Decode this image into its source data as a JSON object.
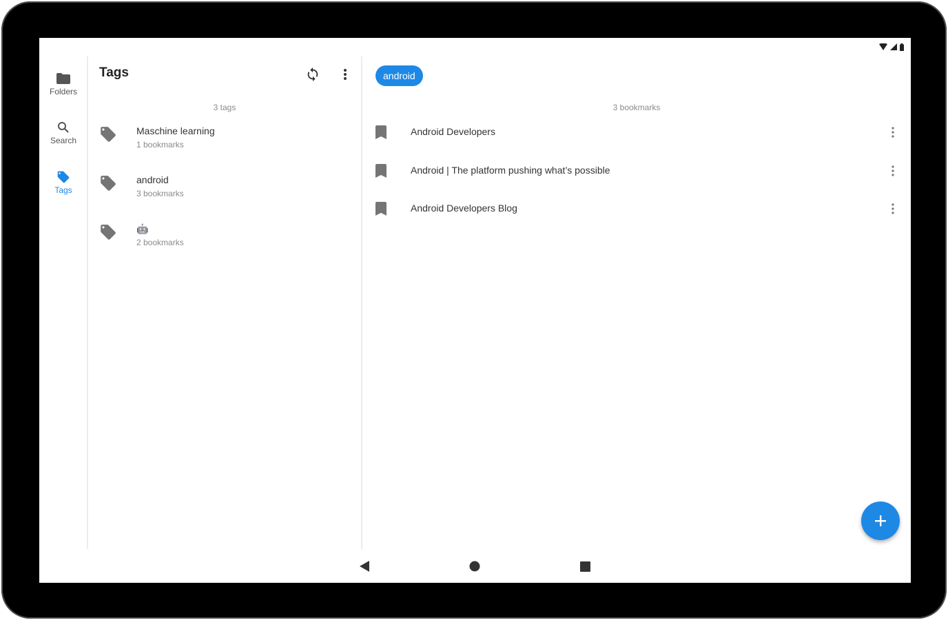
{
  "rail": {
    "items": [
      {
        "label": "Folders",
        "icon": "folder-icon",
        "active": false
      },
      {
        "label": "Search",
        "icon": "search-icon",
        "active": false
      },
      {
        "label": "Tags",
        "icon": "tag-icon",
        "active": true
      }
    ]
  },
  "tags_pane": {
    "title": "Tags",
    "count_label": "3 tags",
    "tags": [
      {
        "name": "Maschine learning",
        "count": "1 bookmarks"
      },
      {
        "name": "android",
        "count": "3 bookmarks"
      },
      {
        "name": "🤖",
        "count": "2 bookmarks"
      }
    ]
  },
  "bookmarks_pane": {
    "chip_label": "android",
    "count_label": "3 bookmarks",
    "bookmarks": [
      {
        "title": "Android Developers"
      },
      {
        "title": "Android | The platform pushing what’s possible"
      },
      {
        "title": "Android Developers Blog"
      }
    ]
  },
  "colors": {
    "accent": "#1e88e5",
    "icon_gray": "#757575",
    "divider": "#ececec"
  },
  "icons": {
    "sync": "sync-icon",
    "overflow": "more-vert-icon",
    "fab": "add-icon",
    "nav_back": "back-triangle-icon",
    "nav_home": "home-circle-icon",
    "nav_recents": "recents-square-icon"
  }
}
